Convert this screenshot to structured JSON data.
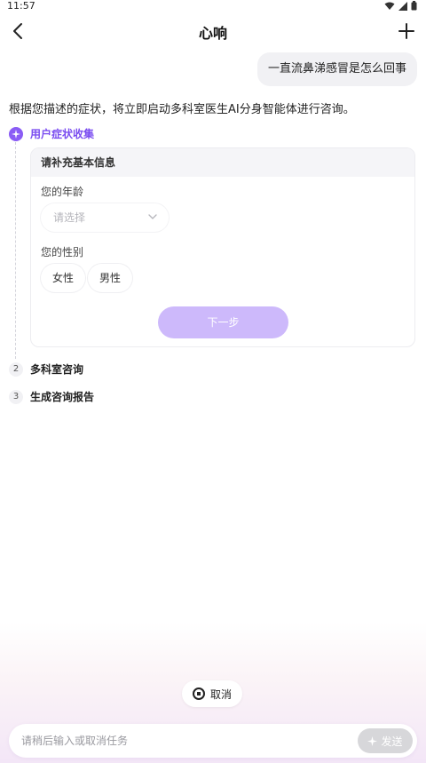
{
  "status_bar": {
    "time": "11:57"
  },
  "header": {
    "title": "心响"
  },
  "chat": {
    "user_message": "一直流鼻涕感冒是怎么回事",
    "assistant_message": "根据您描述的症状，将立即启动多科室医生AI分身智能体进行咨询。"
  },
  "steps": [
    {
      "number": "",
      "label": "用户症状收集"
    },
    {
      "number": "2",
      "label": "多科室咨询"
    },
    {
      "number": "3",
      "label": "生成咨询报告"
    }
  ],
  "form": {
    "header": "请补充基本信息",
    "age_label": "您的年龄",
    "age_placeholder": "请选择",
    "gender_label": "您的性别",
    "gender_options": [
      "女性",
      "男性"
    ],
    "next_label": "下一步"
  },
  "bottom": {
    "cancel_label": "取消",
    "input_placeholder": "请稍后输入或取消任务",
    "send_label": "发送"
  },
  "colors": {
    "accent": "#8a5cf5",
    "next_button": "#cdb9fb",
    "send_button_disabled": "#d7d7da"
  }
}
